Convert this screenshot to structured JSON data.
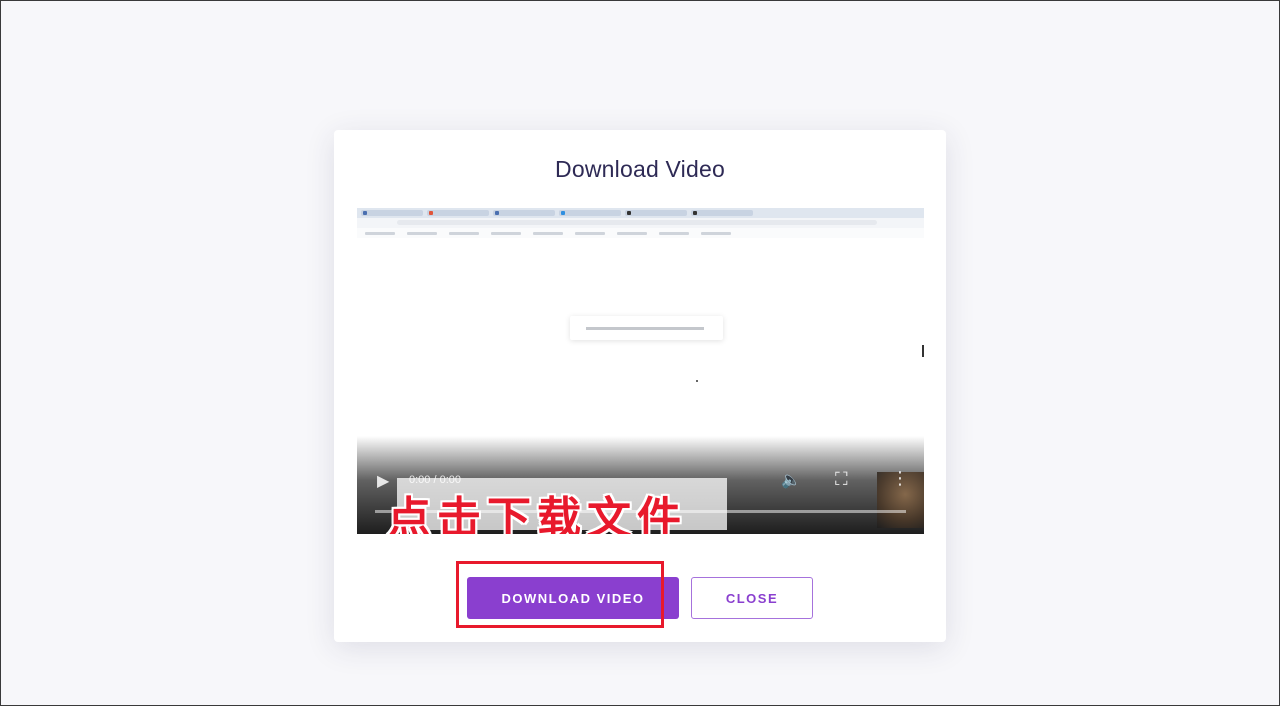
{
  "modal": {
    "title": "Download Video",
    "download_label": "DOWNLOAD VIDEO",
    "close_label": "CLOSE"
  },
  "player": {
    "time": "0:00 / 0:00",
    "progress_fraction": 0.0
  },
  "annotation": {
    "text": "点击下载文件"
  },
  "colors": {
    "accent": "#8a3fcf",
    "annotation_red": "#e8192c"
  },
  "icons": [
    "play-icon",
    "volume-icon",
    "fullscreen-icon",
    "more-vertical-icon"
  ]
}
